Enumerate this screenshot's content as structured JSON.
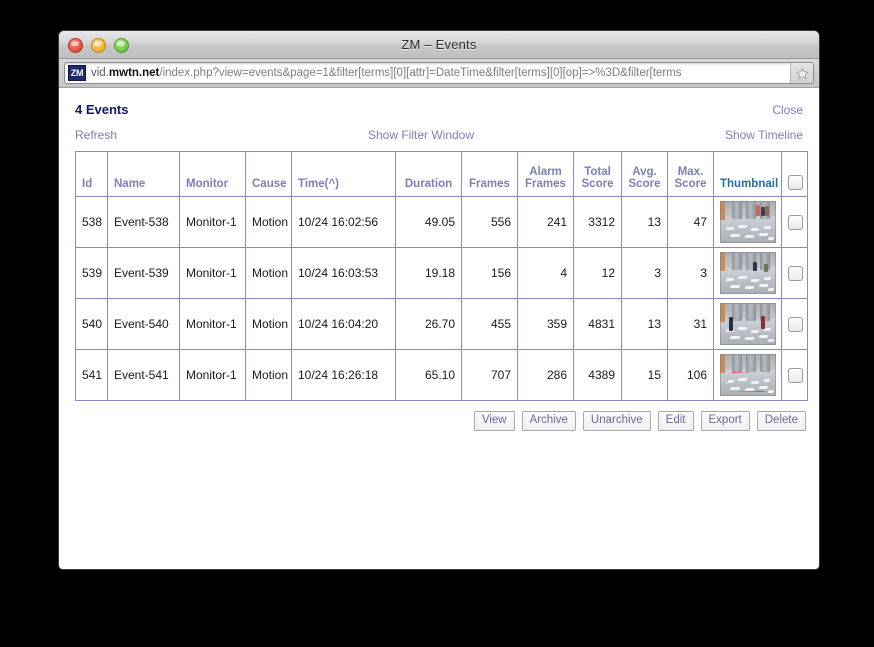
{
  "window": {
    "title": "ZM – Events",
    "traffic_lights": [
      "close",
      "minimize",
      "maximize"
    ]
  },
  "urlbar": {
    "favicon_label": "ZM",
    "url_host_prefix": "vid.",
    "url_host_strong": "mwtn.net",
    "url_path": "/index.php?view=events&page=1&filter[terms][0][attr]=DateTime&filter[terms][0][op]=>%3D&filter[terms",
    "full_url": "vid.mwtn.net/index.php?view=events&page=1&filter[terms][0][attr]=DateTime&filter[terms][0][op]=>%3D&filter[terms",
    "star_icon": "bookmark-star-icon"
  },
  "page": {
    "events_count_label": "4 Events",
    "close_label": "Close",
    "refresh_label": "Refresh",
    "show_filter_label": "Show Filter Window",
    "show_timeline_label": "Show Timeline"
  },
  "table": {
    "columns": [
      {
        "key": "id",
        "label": "Id"
      },
      {
        "key": "name",
        "label": "Name"
      },
      {
        "key": "monitor",
        "label": "Monitor"
      },
      {
        "key": "cause",
        "label": "Cause"
      },
      {
        "key": "time",
        "label": "Time(^)"
      },
      {
        "key": "duration",
        "label": "Duration"
      },
      {
        "key": "frames",
        "label": "Frames"
      },
      {
        "key": "alarm_frames",
        "label": "Alarm Frames"
      },
      {
        "key": "total_score",
        "label": "Total Score"
      },
      {
        "key": "avg_score",
        "label": "Avg. Score"
      },
      {
        "key": "max_score",
        "label": "Max. Score"
      },
      {
        "key": "thumbnail",
        "label": "Thumbnail"
      },
      {
        "key": "select",
        "label": ""
      }
    ],
    "header_labels": {
      "id": "Id",
      "name": "Name",
      "monitor": "Monitor",
      "cause": "Cause",
      "time": "Time(^)",
      "duration": "Duration",
      "frames": "Frames",
      "alarm_frames_l1": "Alarm",
      "alarm_frames_l2": "Frames",
      "total_score_l1": "Total",
      "total_score_l2": "Score",
      "avg_score_l1": "Avg.",
      "avg_score_l2": "Score",
      "max_score_l1": "Max.",
      "max_score_l2": "Score",
      "thumbnail": "Thumbnail"
    },
    "rows": [
      {
        "id": "538",
        "name": "Event-538",
        "monitor": "Monitor-1",
        "cause": "Motion",
        "time": "10/24 16:02:56",
        "duration": "49.05",
        "frames": "556",
        "alarm_frames": "241",
        "total_score": "3312",
        "avg_score": "13",
        "max_score": "47"
      },
      {
        "id": "539",
        "name": "Event-539",
        "monitor": "Monitor-1",
        "cause": "Motion",
        "time": "10/24 16:03:53",
        "duration": "19.18",
        "frames": "156",
        "alarm_frames": "4",
        "total_score": "12",
        "avg_score": "3",
        "max_score": "3"
      },
      {
        "id": "540",
        "name": "Event-540",
        "monitor": "Monitor-1",
        "cause": "Motion",
        "time": "10/24 16:04:20",
        "duration": "26.70",
        "frames": "455",
        "alarm_frames": "359",
        "total_score": "4831",
        "avg_score": "13",
        "max_score": "31"
      },
      {
        "id": "541",
        "name": "Event-541",
        "monitor": "Monitor-1",
        "cause": "Motion",
        "time": "10/24 16:26:18",
        "duration": "65.10",
        "frames": "707",
        "alarm_frames": "286",
        "total_score": "4389",
        "avg_score": "15",
        "max_score": "106"
      }
    ]
  },
  "actions": {
    "view": "View",
    "archive": "Archive",
    "unarchive": "Unarchive",
    "edit": "Edit",
    "export": "Export",
    "delete": "Delete"
  },
  "colors": {
    "link": "#7e7eb8",
    "heading": "#16166b",
    "sorted_header": "#1f6fa8",
    "table_border": "#8a8ac0",
    "page_background": "#000000",
    "window_background": "#ffffff"
  }
}
